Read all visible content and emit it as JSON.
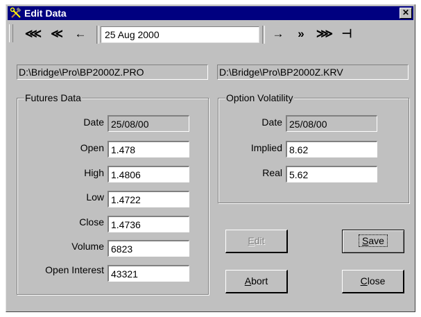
{
  "window": {
    "title": "Edit Data",
    "close_glyph": "✕"
  },
  "nav": {
    "first": "⋘",
    "prev_fast": "≪",
    "prev": "←",
    "date": "25 Aug 2000",
    "next": "→",
    "next_fast": "»",
    "next_faster": "⋙",
    "last": "⊣"
  },
  "paths": {
    "futures_file": "D:\\Bridge\\Pro\\BP2000Z.PRO",
    "volatility_file": "D:\\Bridge\\Pro\\BP2000Z.KRV"
  },
  "futures": {
    "legend": "Futures Data",
    "date_label": "Date",
    "date_value": "25/08/00",
    "open_label": "Open",
    "open_value": "1.478",
    "high_label": "High",
    "high_value": "1.4806",
    "low_label": "Low",
    "low_value": "1.4722",
    "close_label": "Close",
    "close_value": "1.4736",
    "volume_label": "Volume",
    "volume_value": "6823",
    "oi_label": "Open Interest",
    "oi_value": "43321"
  },
  "volatility": {
    "legend": "Option Volatility",
    "date_label": "Date",
    "date_value": "25/08/00",
    "implied_label": "Implied",
    "implied_value": "8.62",
    "real_label": "Real",
    "real_value": "5.62"
  },
  "buttons": {
    "edit": {
      "key": "E",
      "rest": "dit"
    },
    "save": {
      "key": "S",
      "rest": "ave"
    },
    "abort": {
      "key": "A",
      "rest": "bort"
    },
    "close": {
      "key": "C",
      "rest": "lose"
    }
  },
  "icons": {
    "title_icon": "hammer-wrench-icon"
  }
}
